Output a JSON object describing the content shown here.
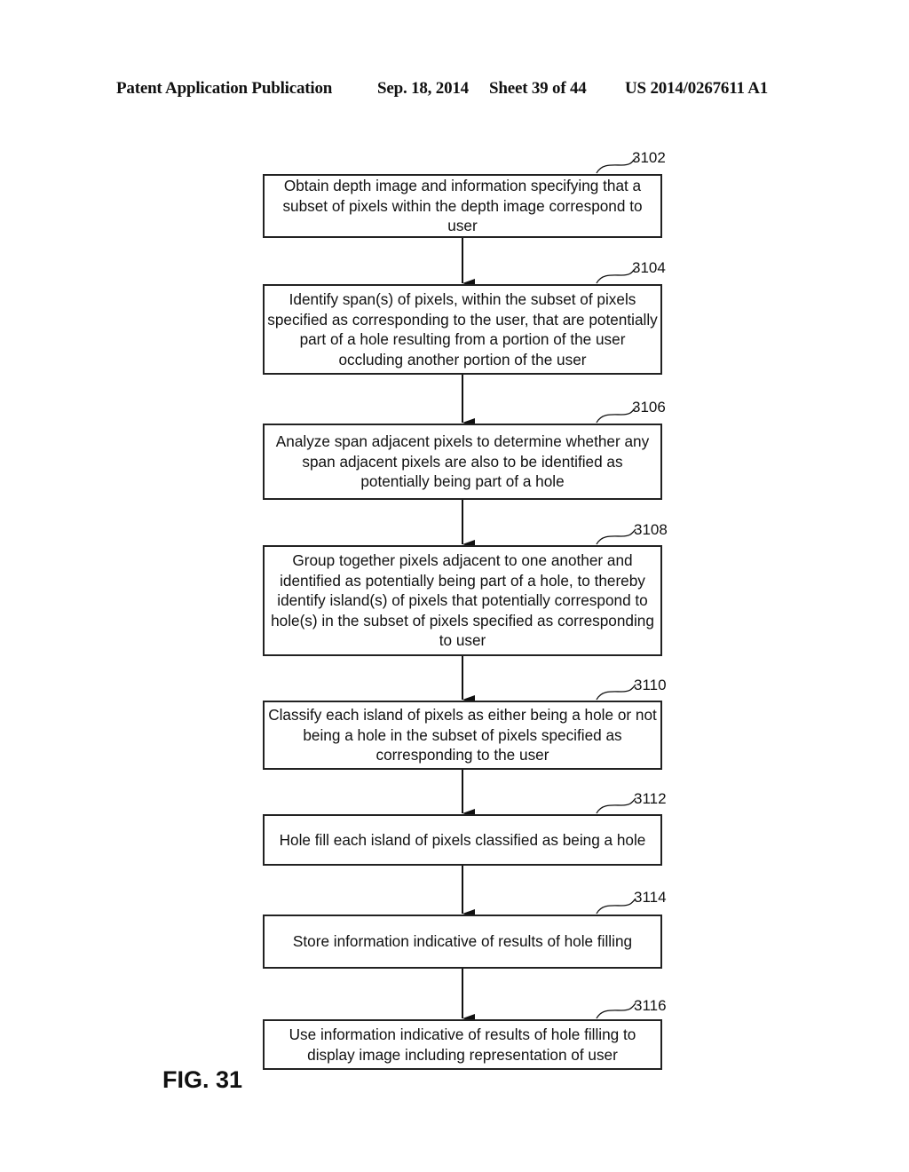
{
  "header": {
    "publication": "Patent Application Publication",
    "date": "Sep. 18, 2014",
    "sheet": "Sheet 39 of 44",
    "number": "US 2014/0267611 A1"
  },
  "figure_label": "FIG. 31",
  "steps": [
    {
      "ref": "3102",
      "text": "Obtain depth image and information specifying that a subset of pixels within the depth image correspond to user"
    },
    {
      "ref": "3104",
      "text": "Identify span(s) of pixels, within the subset of pixels specified as corresponding to the user, that are potentially part of a hole resulting from a portion of the user occluding another portion of the user"
    },
    {
      "ref": "3106",
      "text": "Analyze span adjacent pixels to determine whether any span adjacent pixels are also to be identified as potentially being part of a hole"
    },
    {
      "ref": "3108",
      "text": "Group together pixels adjacent to one another and identified as potentially being part of a hole, to thereby identify island(s) of pixels that potentially correspond to hole(s) in the subset of pixels specified as corresponding to user"
    },
    {
      "ref": "3110",
      "text": "Classify each island of pixels as either being a hole or not being a hole in the subset of pixels specified as corresponding to the user"
    },
    {
      "ref": "3112",
      "text": "Hole fill each island of pixels classified as being a hole"
    },
    {
      "ref": "3114",
      "text": "Store information indicative of results of hole filling"
    },
    {
      "ref": "3116",
      "text": "Use information indicative of results of hole filling to display image including representation of user"
    }
  ]
}
